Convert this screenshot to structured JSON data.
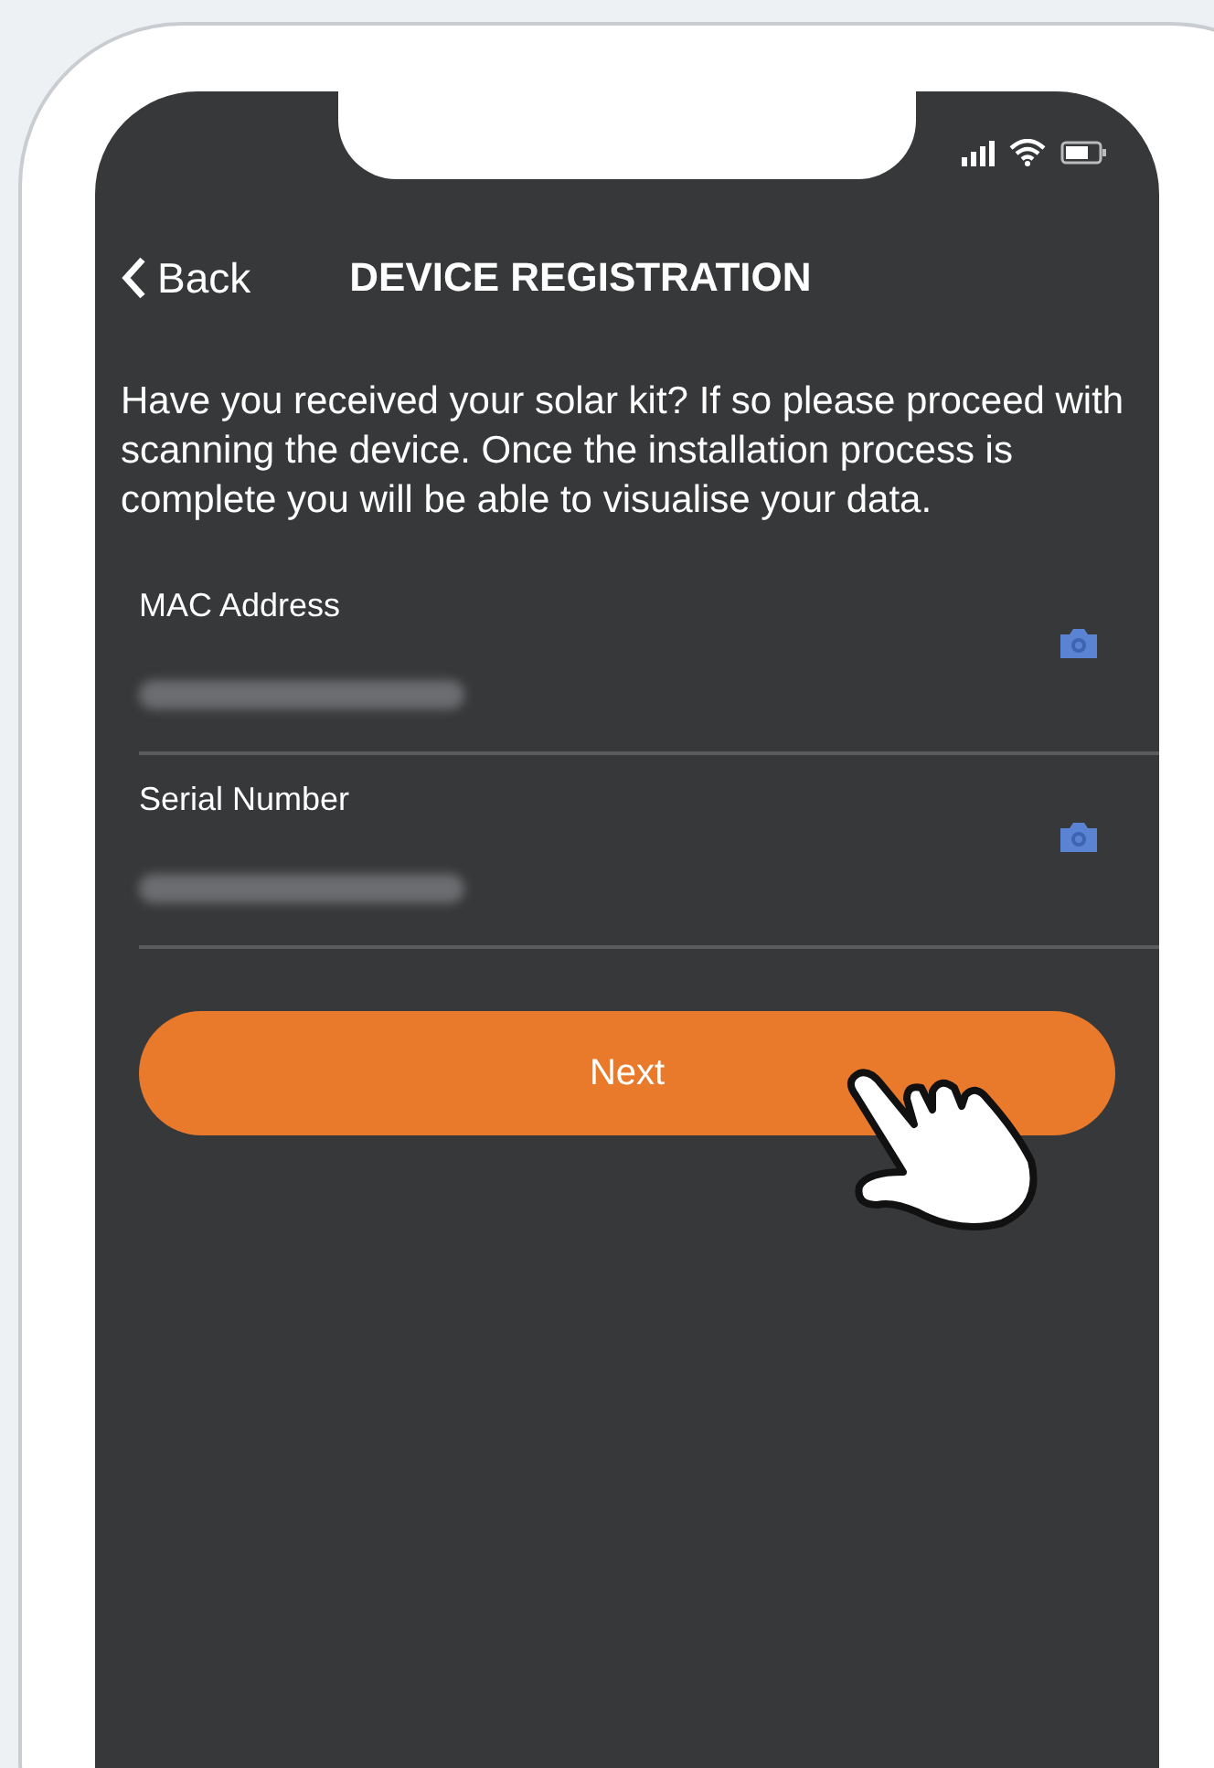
{
  "header": {
    "back_label": "Back",
    "title": "DEVICE REGISTRATION"
  },
  "intro": "Have you received your solar kit? If so please proceed with scanning the device. Once the installation process is complete you will be able to visualise your data.",
  "fields": [
    {
      "label": "MAC Address"
    },
    {
      "label": "Serial Number"
    }
  ],
  "next_button": {
    "label": "Next"
  }
}
